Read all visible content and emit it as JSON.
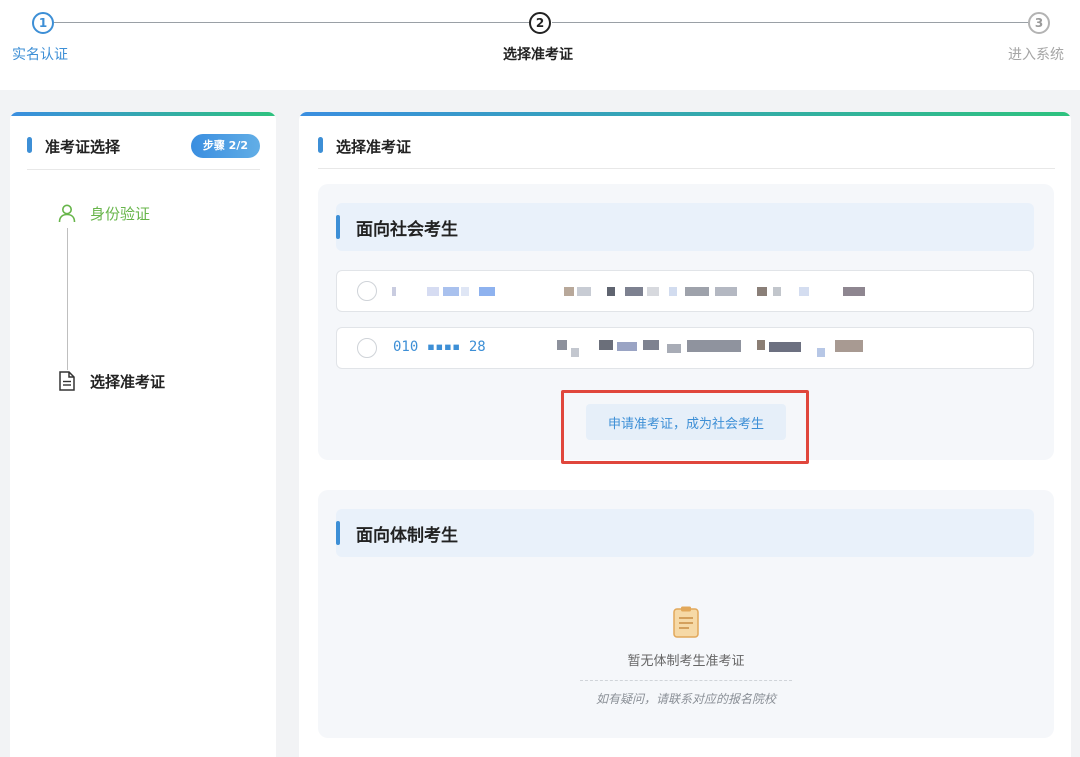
{
  "stepper": {
    "steps": [
      {
        "number": "1",
        "label": "实名认证"
      },
      {
        "number": "2",
        "label": "选择准考证"
      },
      {
        "number": "3",
        "label": "进入系统"
      }
    ]
  },
  "sidebar": {
    "title": "准考证选择",
    "badge": "步骤 2/2",
    "items": [
      {
        "label": "身份验证"
      },
      {
        "label": "选择准考证"
      }
    ]
  },
  "main": {
    "title": "选择准考证",
    "social": {
      "title": "面向社会考生",
      "tickets": [
        {
          "number_visible": ""
        },
        {
          "number_visible": "010 ▪▪▪▪ 28"
        }
      ],
      "apply_button": "申请准考证，成为社会考生"
    },
    "institutional": {
      "title": "面向体制考生",
      "empty_text": "暂无体制考生准考证",
      "empty_hint": "如有疑问，请联系对应的报名院校"
    }
  },
  "colors": {
    "accent": "#3d8fd6",
    "success": "#67b54a",
    "highlight": "#e0463c"
  }
}
